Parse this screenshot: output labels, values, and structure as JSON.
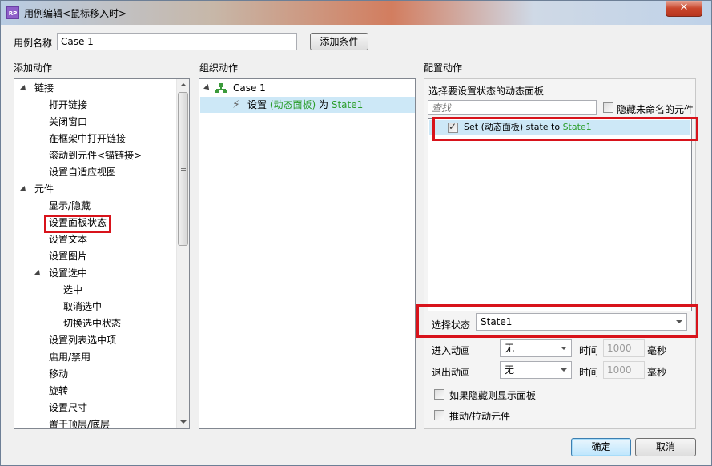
{
  "window": {
    "title": "用例编辑<鼠标移入时>",
    "app_icon": "RP",
    "close_label": "✕"
  },
  "case_name": {
    "label": "用例名称",
    "value": "Case 1",
    "add_condition": "添加条件"
  },
  "sections": {
    "add_actions": "添加动作",
    "organize_actions": "组织动作",
    "configure_actions": "配置动作"
  },
  "action_tree": [
    {
      "label": "链接",
      "level": 0,
      "expander": "open"
    },
    {
      "label": "打开链接",
      "level": 1,
      "expander": "closed"
    },
    {
      "label": "关闭窗口",
      "level": 1,
      "expander": "none"
    },
    {
      "label": "在框架中打开链接",
      "level": 1,
      "expander": "closed"
    },
    {
      "label": "滚动到元件<锚链接>",
      "level": 1,
      "expander": "none"
    },
    {
      "label": "设置自适应视图",
      "level": 1,
      "expander": "none"
    },
    {
      "label": "元件",
      "level": 0,
      "expander": "open"
    },
    {
      "label": "显示/隐藏",
      "level": 1,
      "expander": "closed"
    },
    {
      "label": "设置面板状态",
      "level": 1,
      "expander": "none"
    },
    {
      "label": "设置文本",
      "level": 1,
      "expander": "none"
    },
    {
      "label": "设置图片",
      "level": 1,
      "expander": "none"
    },
    {
      "label": "设置选中",
      "level": 1,
      "expander": "open"
    },
    {
      "label": "选中",
      "level": 2,
      "expander": "none"
    },
    {
      "label": "取消选中",
      "level": 2,
      "expander": "none"
    },
    {
      "label": "切换选中状态",
      "level": 2,
      "expander": "none"
    },
    {
      "label": "设置列表选中项",
      "level": 1,
      "expander": "none"
    },
    {
      "label": "启用/禁用",
      "level": 1,
      "expander": "closed"
    },
    {
      "label": "移动",
      "level": 1,
      "expander": "none"
    },
    {
      "label": "旋转",
      "level": 1,
      "expander": "none"
    },
    {
      "label": "设置尺寸",
      "level": 1,
      "expander": "none"
    },
    {
      "label": "置于顶层/底层",
      "level": 1,
      "expander": "closed"
    }
  ],
  "organize": {
    "case_label": "Case 1",
    "action_prefix": "设置 ",
    "action_target": "(动态面板)",
    "action_mid": " 为 ",
    "action_state": "State1"
  },
  "configure": {
    "choose_panel_label": "选择要设置状态的动态面板",
    "search_placeholder": "查找",
    "hide_unnamed_label": "隐藏未命名的元件",
    "panel_item_prefix": "Set ",
    "panel_item_target": "(动态面板)",
    "panel_item_mid": " state to ",
    "panel_item_state": "State1",
    "select_state_label": "选择状态",
    "select_state_value": "State1",
    "enter_anim_label": "进入动画",
    "enter_anim_value": "无",
    "exit_anim_label": "退出动画",
    "exit_anim_value": "无",
    "time_label": "时间",
    "time_value": "1000",
    "ms_label": "毫秒",
    "show_if_hidden_label": "如果隐藏则显示面板",
    "push_pull_label": "推动/拉动元件"
  },
  "footer": {
    "ok": "确定",
    "cancel": "取消"
  },
  "colors": {
    "highlight_box": "#d8131b",
    "selected_row": "#cde8f7",
    "state_text": "#2a9d2a"
  }
}
